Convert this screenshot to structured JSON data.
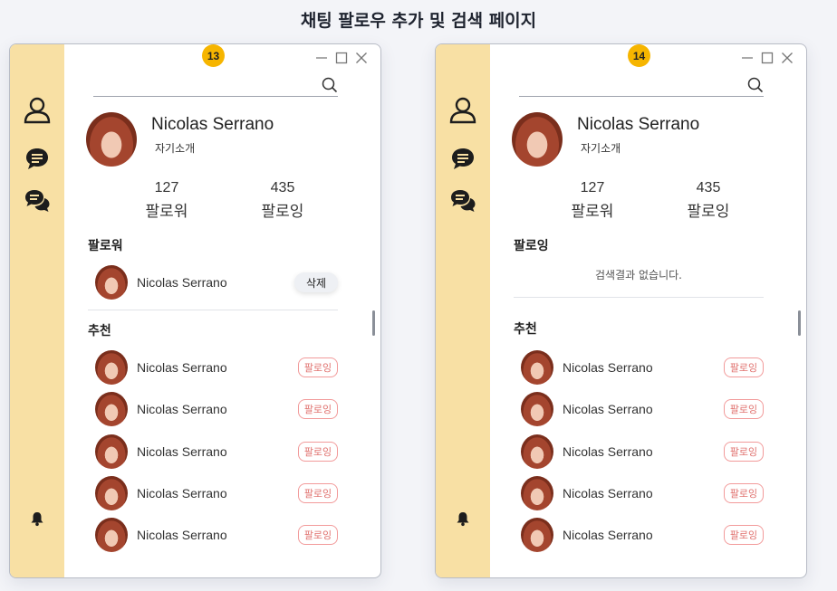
{
  "title": "채팅 팔로우 추가 및 검색 페이지",
  "colors": {
    "sidebar": "#f8e0a4",
    "badge": "#f6b500",
    "follow_border": "#f29a9a",
    "follow_text": "#e0726f"
  },
  "icons": [
    "person-icon",
    "chat-bubble-icon",
    "chat-multi-icon",
    "bell-icon",
    "search-icon",
    "minimize-icon",
    "maximize-icon",
    "close-icon"
  ],
  "windows": [
    {
      "badge": "13",
      "search": {
        "value": "",
        "placeholder": ""
      },
      "profile": {
        "name": "Nicolas Serrano",
        "bio": "자기소개"
      },
      "stats": [
        {
          "count": "127",
          "label": "팔로워"
        },
        {
          "count": "435",
          "label": "팔로잉"
        }
      ],
      "section_follow": "팔로워",
      "followers": [
        {
          "name": "Nicolas Serrano",
          "action": "삭제"
        }
      ],
      "section_recommend": "추천",
      "recommend": [
        {
          "name": "Nicolas Serrano",
          "action": "팔로잉"
        },
        {
          "name": "Nicolas Serrano",
          "action": "팔로잉"
        },
        {
          "name": "Nicolas Serrano",
          "action": "팔로잉"
        },
        {
          "name": "Nicolas Serrano",
          "action": "팔로잉"
        },
        {
          "name": "Nicolas Serrano",
          "action": "팔로잉"
        }
      ]
    },
    {
      "badge": "14",
      "search": {
        "value": "",
        "placeholder": ""
      },
      "profile": {
        "name": "Nicolas Serrano",
        "bio": "자기소개"
      },
      "stats": [
        {
          "count": "127",
          "label": "팔로워"
        },
        {
          "count": "435",
          "label": "팔로잉"
        }
      ],
      "section_follow": "팔로잉",
      "empty_text": "검색결과 없습니다.",
      "section_recommend": "추천",
      "recommend": [
        {
          "name": "Nicolas Serrano",
          "action": "팔로잉"
        },
        {
          "name": "Nicolas Serrano",
          "action": "팔로잉"
        },
        {
          "name": "Nicolas Serrano",
          "action": "팔로잉"
        },
        {
          "name": "Nicolas Serrano",
          "action": "팔로잉"
        },
        {
          "name": "Nicolas Serrano",
          "action": "팔로잉"
        }
      ]
    }
  ]
}
